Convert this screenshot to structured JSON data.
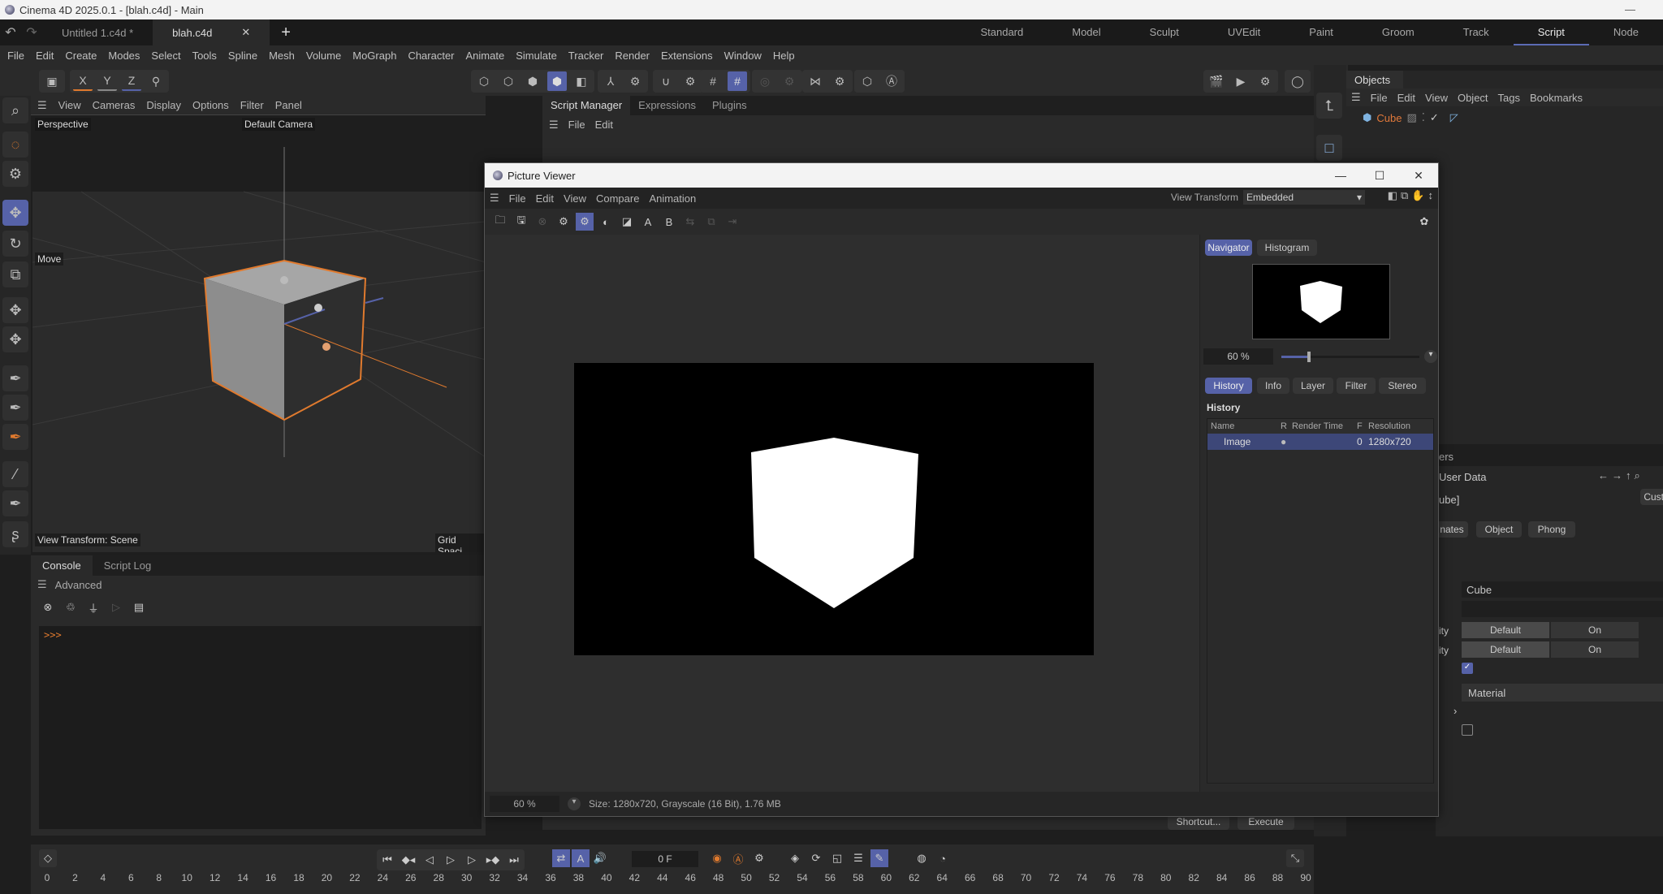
{
  "os_title": "Cinema 4D 2025.0.1 - [blah.c4d] - Main",
  "doc_tabs": [
    {
      "label": "Untitled 1.c4d *",
      "active": false
    },
    {
      "label": "blah.c4d",
      "active": true
    }
  ],
  "layouts": [
    "Standard",
    "Model",
    "Sculpt",
    "UVEdit",
    "Paint",
    "Groom",
    "Track",
    "Script",
    "Node"
  ],
  "active_layout": "Script",
  "main_menu": [
    "File",
    "Edit",
    "Create",
    "Modes",
    "Select",
    "Tools",
    "Spline",
    "Mesh",
    "Volume",
    "MoGraph",
    "Character",
    "Animate",
    "Simulate",
    "Tracker",
    "Render",
    "Extensions",
    "Window",
    "Help"
  ],
  "axis_buttons": [
    "X",
    "Y",
    "Z"
  ],
  "viewport": {
    "menu": [
      "View",
      "Cameras",
      "Display",
      "Options",
      "Filter",
      "Panel"
    ],
    "view_name": "Perspective",
    "camera": "Default Camera",
    "tool_label": "Move",
    "view_transform": "View Transform: Scene",
    "grid_spacing": "Grid Spaci"
  },
  "console": {
    "tabs": [
      "Console",
      "Script Log"
    ],
    "mode": "Advanced",
    "prompt": ">>>"
  },
  "script_manager": {
    "tabs": [
      "Script Manager",
      "Expressions",
      "Plugins"
    ],
    "menu": [
      "File",
      "Edit"
    ],
    "buttons": {
      "shortcut": "Shortcut...",
      "execute": "Execute"
    }
  },
  "objects": {
    "tab": "Objects",
    "menu": [
      "File",
      "Edit",
      "View",
      "Object",
      "Tags",
      "Bookmarks"
    ],
    "items": [
      {
        "name": "Cube",
        "color": "#e0783a"
      }
    ]
  },
  "attributes": {
    "title_fragment": "ers",
    "mode": "User Data",
    "object": "ube]",
    "custom_btn": "Custo",
    "tabs": [
      "nates",
      "Object",
      "Phong"
    ],
    "name_value": "Cube",
    "rows": [
      {
        "label": "ity",
        "left": "Default",
        "right": "On"
      },
      {
        "label": "ity",
        "left": "Default",
        "right": "On"
      }
    ],
    "checkbox_checked": true,
    "material_label": "Material",
    "checkbox2_checked": false
  },
  "picture_viewer": {
    "title": "Picture Viewer",
    "menu": [
      "File",
      "Edit",
      "View",
      "Compare",
      "Animation"
    ],
    "view_transform_label": "View Transform",
    "view_transform_value": "Embedded",
    "nav_tabs": [
      "Navigator",
      "Histogram"
    ],
    "zoom": "60 %",
    "zoom_fraction": 0.19,
    "info_tabs": [
      "History",
      "Info",
      "Layer",
      "Filter",
      "Stereo"
    ],
    "history_heading": "History",
    "history_columns": [
      "Name",
      "R",
      "Render Time",
      "F",
      "Resolution"
    ],
    "history_rows": [
      {
        "name": "Image",
        "r": "●",
        "render_time": "",
        "f": "0",
        "resolution": "1280x720"
      }
    ],
    "status_zoom": "60 %",
    "status_text": "Size: 1280x720, Grayscale (16 Bit), 1.76 MB"
  },
  "timeline": {
    "current_frame": "0 F",
    "ticks": [
      "0",
      "2",
      "4",
      "6",
      "8",
      "10",
      "12",
      "14",
      "16",
      "18",
      "20",
      "22",
      "24",
      "26",
      "28",
      "30",
      "32",
      "34",
      "36",
      "38",
      "40",
      "42",
      "44",
      "46",
      "48",
      "50",
      "52",
      "54",
      "56",
      "58",
      "60",
      "62",
      "64",
      "66",
      "68",
      "70",
      "72",
      "74",
      "76",
      "78",
      "80",
      "82",
      "84",
      "86",
      "88",
      "90"
    ]
  },
  "colors": {
    "accent": "#5662a8",
    "selection": "#e0783a"
  }
}
